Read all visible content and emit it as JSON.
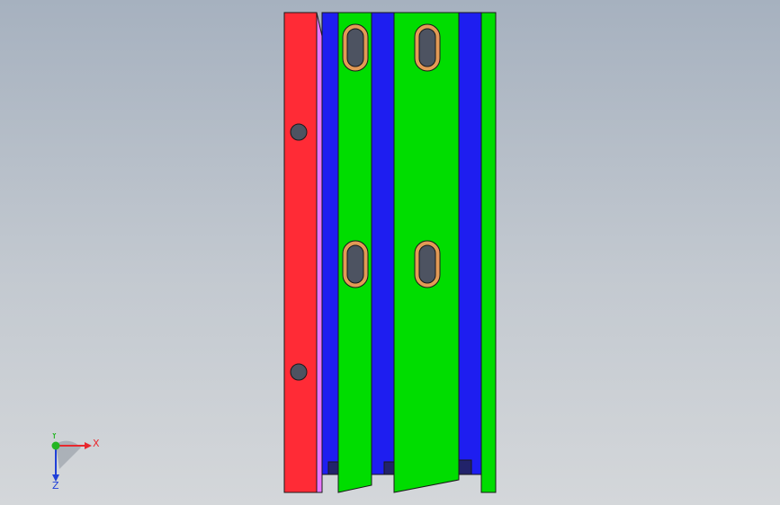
{
  "viewport": {
    "background_top": "#a6b1bf",
    "background_bottom": "#d4d7da"
  },
  "model": {
    "colors": {
      "red_plate": "#ff2b36",
      "green_plate": "#00dd00",
      "blue_plate": "#1e1ef0",
      "pink_strip": "#e978ff",
      "slot_ring": "#e39a55",
      "slot_fill": "#4d5361",
      "hole_fill": "#4d5361",
      "edge": "#1a1a1a"
    }
  },
  "triad": {
    "x_label": "X",
    "y_label": "Y",
    "z_label": "Z",
    "x_color": "#e8282e",
    "y_color": "#22b522",
    "z_color": "#2040d8"
  }
}
